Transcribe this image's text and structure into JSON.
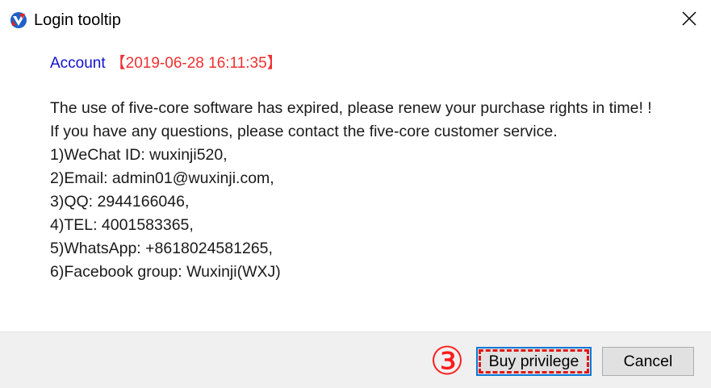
{
  "window": {
    "title": "Login tooltip",
    "app_icon": "app-logo-icon",
    "close_icon": "close-icon"
  },
  "account": {
    "label": "Account",
    "timestamp": "【2019-06-28 16:11:35】"
  },
  "message": {
    "expired_notice": "The use of five-core software has expired, please renew your purchase rights in time! !",
    "contact_intro": "If you have any questions, please contact the five-core customer service.",
    "contacts": [
      "1)WeChat ID: wuxinji520,",
      "2)Email: admin01@wuxinji.com,",
      "3)QQ: 2944166046,",
      "4)TEL: 4001583365,",
      "5)WhatsApp: +8618024581265,",
      "6)Facebook group: Wuxinji(WXJ)"
    ]
  },
  "footer": {
    "step_marker": "③",
    "buy_label": "Buy privilege",
    "cancel_label": "Cancel"
  },
  "colors": {
    "account_label": "#1010d0",
    "timestamp": "#f03030",
    "annotation": "#ff1a1a",
    "focus": "#0a78d7"
  }
}
